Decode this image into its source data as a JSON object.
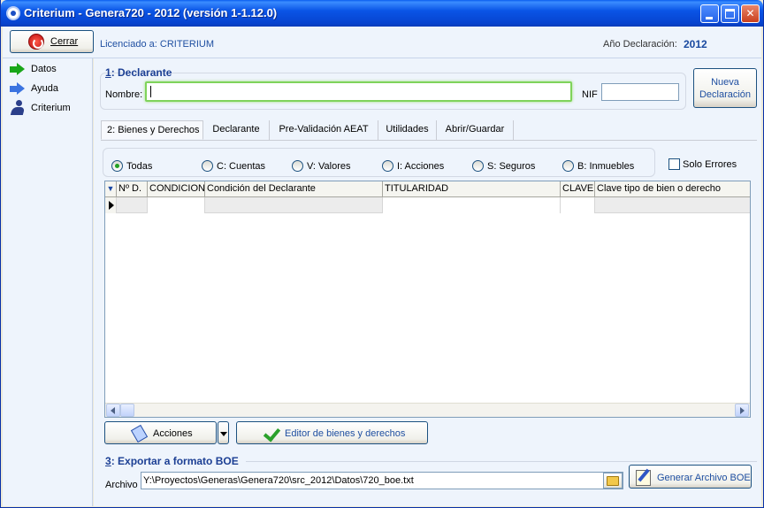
{
  "window": {
    "title": "Criterium - Genera720 - 2012 (versión 1-1.12.0)"
  },
  "topbar": {
    "close_label": "Cerrar",
    "licensed_text": "Licenciado a: CRITERIUM",
    "year_label": "Año Declaración:",
    "year_value": "2012"
  },
  "sidebar": {
    "items": [
      {
        "label": "Datos",
        "icon": "arrow-right-green-icon"
      },
      {
        "label": "Ayuda",
        "icon": "arrow-right-blue-icon"
      },
      {
        "label": "Criterium",
        "icon": "person-icon"
      }
    ]
  },
  "declarante": {
    "section_number": "1",
    "section_title": ": Declarante",
    "name_label": "Nombre:",
    "name_value": "",
    "nif_label": "NIF",
    "nif_value": "",
    "new_button_line1": "Nueva",
    "new_button_line2": "Declaración"
  },
  "tabs": [
    {
      "label": "2: Bienes y Derechos",
      "active": true
    },
    {
      "label": "Declarante",
      "active": false
    },
    {
      "label": "Pre-Validación AEAT",
      "active": false
    },
    {
      "label": "Utilidades",
      "active": false
    },
    {
      "label": "Abrir/Guardar",
      "active": false
    }
  ],
  "filters": {
    "radios": [
      {
        "label": "Todas",
        "checked": true
      },
      {
        "label": "C: Cuentas",
        "checked": false
      },
      {
        "label": "V: Valores",
        "checked": false
      },
      {
        "label": "I: Acciones",
        "checked": false
      },
      {
        "label": "S: Seguros",
        "checked": false
      },
      {
        "label": "B: Inmuebles",
        "checked": false
      }
    ],
    "errors_only_label": "Solo Errores",
    "errors_only_checked": false
  },
  "grid": {
    "indicator": "▼",
    "columns": [
      "Nº D.",
      "CONDICION",
      "Condición del Declarante",
      "TITULARIDAD",
      "CLAVE",
      "Clave tipo de bien o derecho"
    ]
  },
  "actions": {
    "acciones_label": "Acciones",
    "editor_label": "Editor de bienes y derechos"
  },
  "export": {
    "section_number": "3",
    "section_title": ": Exportar a formato BOE",
    "file_label": "Archivo",
    "file_value": "Y:\\Proyectos\\Generas\\Genera720\\src_2012\\Datos\\720_boe.txt",
    "generate_label": "Generar Archivo BOE"
  },
  "colors": {
    "titlebar": "#0a55e6",
    "accent_text": "#1f4fa1",
    "focus_border": "#7fd35b"
  }
}
